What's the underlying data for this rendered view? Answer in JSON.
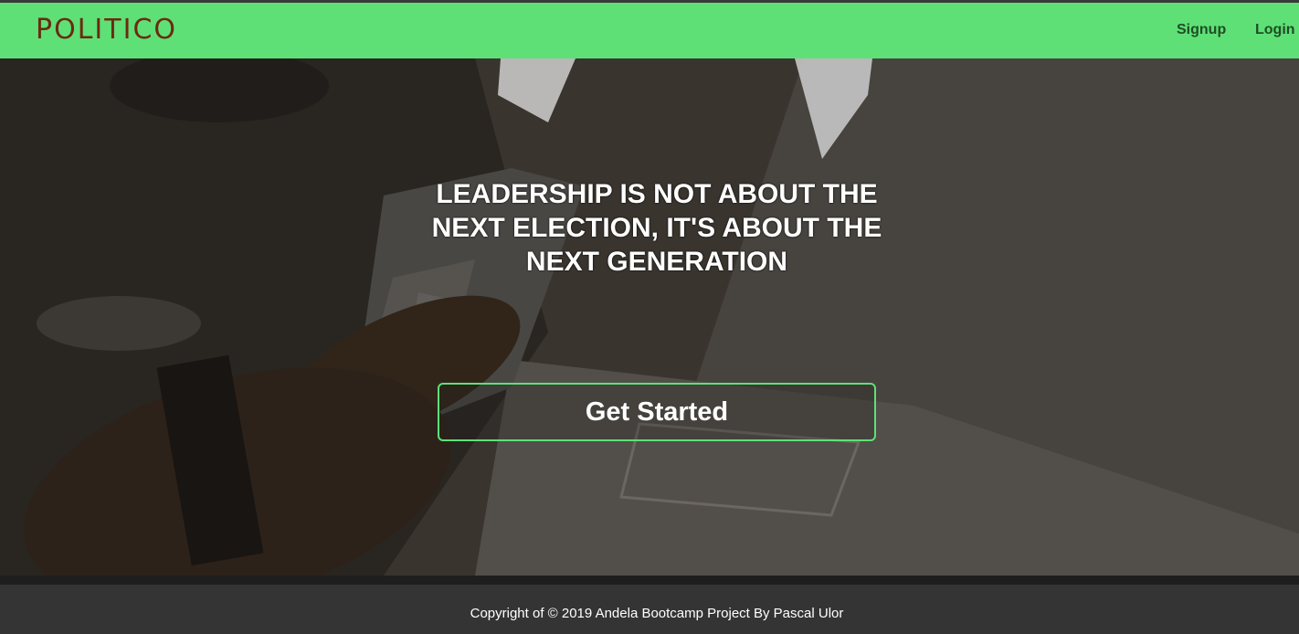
{
  "navbar": {
    "brand": "POLITICO",
    "links": [
      "Signup",
      "Login"
    ]
  },
  "hero": {
    "headline": "LEADERSHIP IS NOT ABOUT THE NEXT ELECTION, IT'S ABOUT THE NEXT GENERATION",
    "cta_label": "Get Started"
  },
  "footer": {
    "copyright": "Copyright of © 2019 Andela Bootcamp Project By Pascal Ulor"
  },
  "colors": {
    "navbar_bg": "#5ee077",
    "brand_text": "#6b2a10",
    "nav_link_text": "#1f4d24",
    "cta_border": "#5ee077",
    "footer_bg": "#343434"
  }
}
